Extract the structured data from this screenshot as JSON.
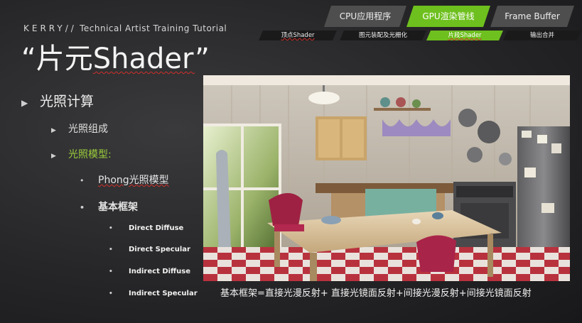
{
  "nav": {
    "top_tabs": [
      {
        "label": "CPU应用程序",
        "active": false
      },
      {
        "label": "GPU渲染管线",
        "active": true
      },
      {
        "label": "Frame Buffer",
        "active": false
      }
    ],
    "sub_tabs": [
      {
        "label": "顶点Shader",
        "active": false
      },
      {
        "label": "图元装配及光栅化",
        "active": false
      },
      {
        "label": "片段Shader",
        "active": true
      },
      {
        "label": "输出合并",
        "active": false
      }
    ]
  },
  "header": {
    "brand_kerry": "KERRY//",
    "brand_rest": "Technical Artist Training Tutorial",
    "title_open": "“片元",
    "title_shader": "Shader",
    "title_close": "”"
  },
  "outline": {
    "level1": "光照计算",
    "level2": [
      "光照组成",
      "光照模型:"
    ],
    "level3": [
      "Phong光照模型",
      "基本框架"
    ],
    "level4": [
      "Direct Diffuse",
      "Direct Specular",
      "Indirect Diffuse",
      "Indirect Specular"
    ]
  },
  "formula": "基本框架=直接光漫反射+ 直接光镜面反射+间接光漫反射+间接光镜面反射",
  "colors": {
    "accent_green": "#6ec01e",
    "highlight_text_green": "#9ccf3a",
    "tab_gray": "#4e4e4e",
    "background": "#262628"
  }
}
